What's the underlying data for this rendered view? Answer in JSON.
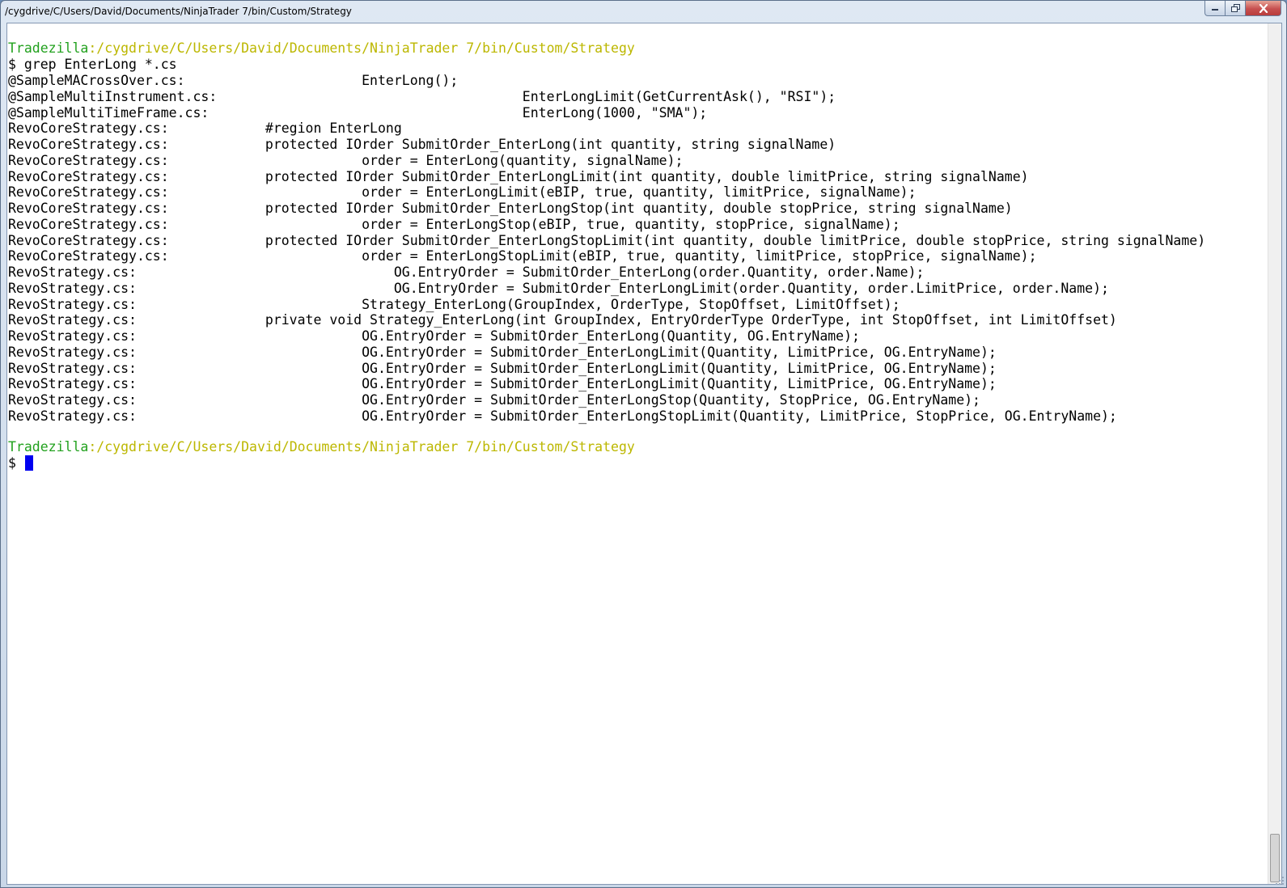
{
  "window": {
    "title": "/cygdrive/C/Users/David/Documents/NinjaTrader 7/bin/Custom/Strategy"
  },
  "prompt": {
    "host": "Tradezilla",
    "colon": ":",
    "path": "/cygdrive/C/Users/David/Documents/NinjaTrader 7/bin/Custom/Strategy"
  },
  "command": "$ grep EnterLong *.cs",
  "prompt_symbol": "$ ",
  "output_lines": [
    "@SampleMACrossOver.cs:                      EnterLong();",
    "@SampleMultiInstrument.cs:                                      EnterLongLimit(GetCurrentAsk(), \"RSI\");",
    "@SampleMultiTimeFrame.cs:                                       EnterLong(1000, \"SMA\");",
    "RevoCoreStrategy.cs:            #region EnterLong",
    "RevoCoreStrategy.cs:            protected IOrder SubmitOrder_EnterLong(int quantity, string signalName)",
    "RevoCoreStrategy.cs:                        order = EnterLong(quantity, signalName);",
    "RevoCoreStrategy.cs:            protected IOrder SubmitOrder_EnterLongLimit(int quantity, double limitPrice, string signalName)",
    "RevoCoreStrategy.cs:                        order = EnterLongLimit(eBIP, true, quantity, limitPrice, signalName);",
    "RevoCoreStrategy.cs:            protected IOrder SubmitOrder_EnterLongStop(int quantity, double stopPrice, string signalName)",
    "RevoCoreStrategy.cs:                        order = EnterLongStop(eBIP, true, quantity, stopPrice, signalName);",
    "RevoCoreStrategy.cs:            protected IOrder SubmitOrder_EnterLongStopLimit(int quantity, double limitPrice, double stopPrice, string signalName)",
    "RevoCoreStrategy.cs:                        order = EnterLongStopLimit(eBIP, true, quantity, limitPrice, stopPrice, signalName);",
    "RevoStrategy.cs:                                OG.EntryOrder = SubmitOrder_EnterLong(order.Quantity, order.Name);",
    "RevoStrategy.cs:                                OG.EntryOrder = SubmitOrder_EnterLongLimit(order.Quantity, order.LimitPrice, order.Name);",
    "RevoStrategy.cs:                            Strategy_EnterLong(GroupIndex, OrderType, StopOffset, LimitOffset);",
    "RevoStrategy.cs:                private void Strategy_EnterLong(int GroupIndex, EntryOrderType OrderType, int StopOffset, int LimitOffset)",
    "RevoStrategy.cs:                            OG.EntryOrder = SubmitOrder_EnterLong(Quantity, OG.EntryName);",
    "RevoStrategy.cs:                            OG.EntryOrder = SubmitOrder_EnterLongLimit(Quantity, LimitPrice, OG.EntryName);",
    "RevoStrategy.cs:                            OG.EntryOrder = SubmitOrder_EnterLongLimit(Quantity, LimitPrice, OG.EntryName);",
    "RevoStrategy.cs:                            OG.EntryOrder = SubmitOrder_EnterLongLimit(Quantity, LimitPrice, OG.EntryName);",
    "RevoStrategy.cs:                            OG.EntryOrder = SubmitOrder_EnterLongStop(Quantity, StopPrice, OG.EntryName);",
    "RevoStrategy.cs:                            OG.EntryOrder = SubmitOrder_EnterLongStopLimit(Quantity, LimitPrice, StopPrice, OG.EntryName);"
  ],
  "colors": {
    "host": "#22a11e",
    "path": "#bcb700",
    "cursor": "#0000f0",
    "background": "#ffffff"
  }
}
